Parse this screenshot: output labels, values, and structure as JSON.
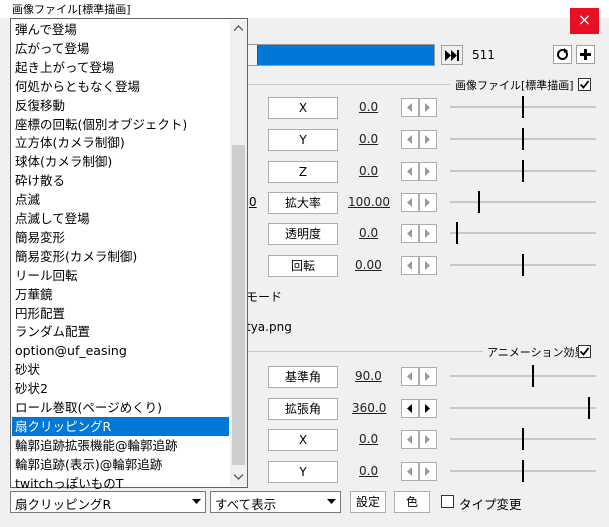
{
  "window": {
    "title": "画像ファイル[標準描画]",
    "close_glyph": "×"
  },
  "timeline": {
    "frame": "511"
  },
  "section_image": {
    "label": "画像ファイル[標準描画]",
    "checked": true
  },
  "section_anim": {
    "label": "アニメーション効果",
    "checked": true
  },
  "rows_image": [
    {
      "label": "X",
      "value": "0.0"
    },
    {
      "label": "Y",
      "value": "0.0"
    },
    {
      "label": "Z",
      "value": "0.0"
    },
    {
      "label": "拡大率",
      "value": "100.00"
    },
    {
      "label": "透明度",
      "value": "0.0"
    },
    {
      "label": "回転",
      "value": "0.00"
    }
  ],
  "rows_anim": [
    {
      "label": "基準角",
      "value": "90.0"
    },
    {
      "label": "拡張角",
      "value": "360.0"
    },
    {
      "label": "X",
      "value": "0.0"
    },
    {
      "label": "Y",
      "value": "0.0"
    }
  ],
  "fragments": {
    "mode": "モード",
    "filename": "tya.png"
  },
  "effect_list": {
    "items": [
      "弾んで登場",
      "広がって登場",
      "起き上がって登場",
      "何処からともなく登場",
      "反復移動",
      "座標の回転(個別オブジェクト)",
      "立方体(カメラ制御)",
      "球体(カメラ制御)",
      "砕け散る",
      "点滅",
      "点滅して登場",
      "簡易変形",
      "簡易変形(カメラ制御)",
      "リール回転",
      "万華鏡",
      "円形配置",
      "ランダム配置",
      "option@uf_easing",
      "砂状",
      "砂状2",
      "ロール巻取(ページめくり)",
      "扇クリッピングR",
      "輪郭追跡拡張機能@輪郭追跡",
      "輪郭追跡(表示)@輪郭追跡",
      "twitchっぽいものT"
    ],
    "selected_index": 21
  },
  "bottom": {
    "effect_combo": "扇クリッピングR",
    "filter_combo": "すべて表示",
    "settings_label": "設定",
    "color_label": "色",
    "type_change_label": "タイプ変更",
    "type_change_checked": false
  }
}
